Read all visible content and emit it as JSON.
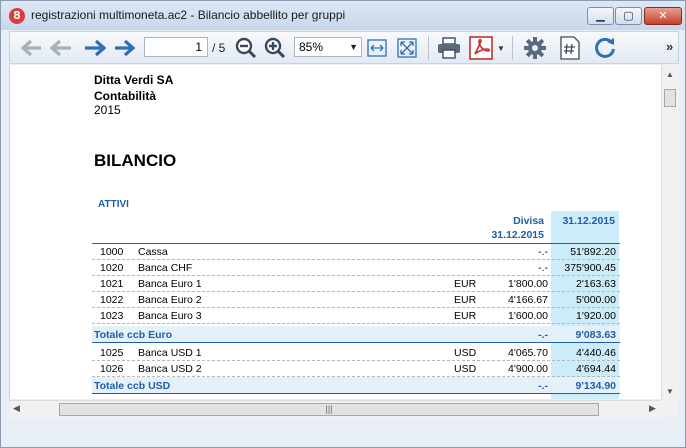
{
  "window": {
    "title": "registrazioni multimoneta.ac2 - Bilancio abbellito per gruppi",
    "app_icon_glyph": "8",
    "controls": {
      "minimize": "▁",
      "maximize": "▢",
      "close": "✕"
    }
  },
  "toolbar": {
    "page_current": "1",
    "page_total": "/ 5",
    "zoom": "85%",
    "more": "»",
    "icons": [
      "first-page-icon",
      "previous-page-icon",
      "next-page-icon",
      "last-page-icon",
      "zoom-out-icon",
      "zoom-in-icon",
      "fit-width-icon",
      "fit-page-icon",
      "print-icon",
      "pdf-icon",
      "settings-icon",
      "page-number-icon",
      "refresh-icon"
    ]
  },
  "report": {
    "company": "Ditta Verdi SA",
    "subtitle": "Contabilità",
    "year": "2015",
    "title": "BILANCIO",
    "section": "ATTIVI",
    "col_divisa": "Divisa",
    "col_divisa_date": "31.12.2015",
    "col_balance_date": "31.12.2015",
    "rows": [
      {
        "code": "1000",
        "desc": "Cassa",
        "cur": "",
        "amt": "-.-",
        "bal": "51'892.20"
      },
      {
        "code": "1020",
        "desc": "Banca CHF",
        "cur": "",
        "amt": "-.-",
        "bal": "375'900.45"
      },
      {
        "code": "1021",
        "desc": "Banca Euro 1",
        "cur": "EUR",
        "amt": "1'800.00",
        "bal": "2'163.63"
      },
      {
        "code": "1022",
        "desc": "Banca Euro 2",
        "cur": "EUR",
        "amt": "4'166.67",
        "bal": "5'000.00"
      },
      {
        "code": "1023",
        "desc": "Banca Euro 3",
        "cur": "EUR",
        "amt": "1'600.00",
        "bal": "1'920.00"
      }
    ],
    "total_eur": {
      "label": "Totale ccb Euro",
      "amt": "-.-",
      "bal": "9'083.63"
    },
    "rows2": [
      {
        "code": "1025",
        "desc": "Banca USD 1",
        "cur": "USD",
        "amt": "4'065.70",
        "bal": "4'440.46"
      },
      {
        "code": "1026",
        "desc": "Banca USD 2",
        "cur": "USD",
        "amt": "4'900.00",
        "bal": "4'694.44"
      }
    ],
    "total_usd": {
      "label": "Totale ccb USD",
      "amt": "-.-",
      "bal": "9'134.90"
    },
    "colors": {
      "accent": "#1f5fa8",
      "highlight": "#ccecfa",
      "total_bg": "#e4f1fb"
    }
  }
}
